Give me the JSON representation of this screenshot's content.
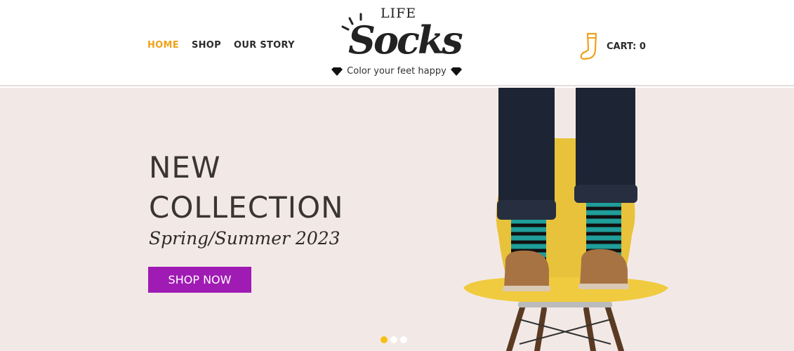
{
  "nav": {
    "items": [
      {
        "label": "HOME",
        "active": true
      },
      {
        "label": "SHOP",
        "active": false
      },
      {
        "label": "OUR STORY",
        "active": false
      }
    ]
  },
  "logo": {
    "top_word": "LIFE",
    "main_word": "Socks",
    "tagline": "Color your feet happy"
  },
  "cart": {
    "label": "CART: 0",
    "icon": "sock-icon"
  },
  "hero": {
    "title_line1": "NEW",
    "title_line2": "COLLECTION",
    "subtitle": "Spring/Summer 2023",
    "button_label": "SHOP NOW",
    "image": "person-in-striped-socks-standing-on-yellow-chair"
  },
  "slider": {
    "slides": 3,
    "active_index": 0
  },
  "colors": {
    "accent": "#f0a11a",
    "button": "#a01bb3",
    "hero_bg": "#f2e9e6",
    "dot_active": "#f4c015"
  }
}
